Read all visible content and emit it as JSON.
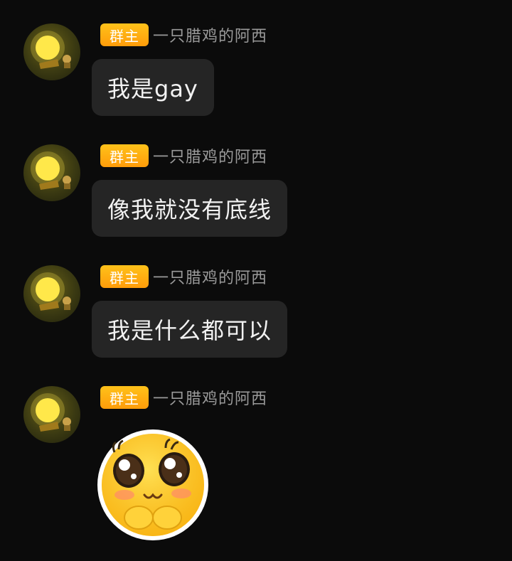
{
  "messages": [
    {
      "role_badge": "群主",
      "sender": "一只腊鸡的阿西",
      "text": "我是gay"
    },
    {
      "role_badge": "群主",
      "sender": "一只腊鸡的阿西",
      "text": "像我就没有底线"
    },
    {
      "role_badge": "群主",
      "sender": "一只腊鸡的阿西",
      "text": "我是什么都可以"
    },
    {
      "role_badge": "群主",
      "sender": "一只腊鸡的阿西",
      "sticker": "shy-cute-emoji-sticker"
    }
  ],
  "colors": {
    "background": "#0b0b0b",
    "bubble": "#252525",
    "badge": "#ff9c0a",
    "sender_text": "#9a9a9a",
    "message_text": "#f2f2f2"
  }
}
